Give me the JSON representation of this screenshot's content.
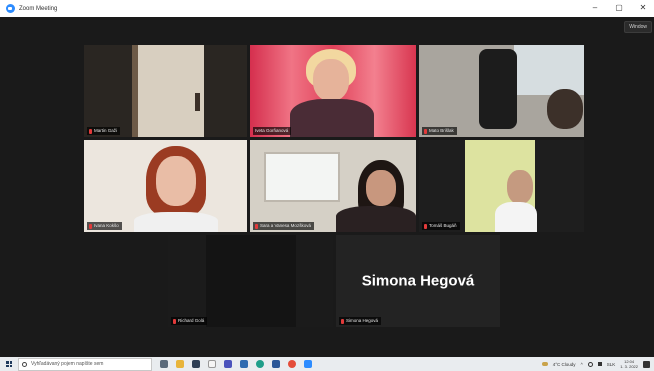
{
  "window": {
    "title": "Zoom Meeting",
    "controls": [
      "–",
      "▢",
      "✕"
    ],
    "view_button": "Window"
  },
  "participants": [
    {
      "name": "Martin Gaži",
      "muted": true
    },
    {
      "name": "Iveta Gorňanová",
      "muted": true,
      "active_speaker": true
    },
    {
      "name": "Mato Brišlak",
      "muted": true
    },
    {
      "name": "Ivana Kokšo",
      "muted": true
    },
    {
      "name": "Sara a Vanesa Mozšková",
      "muted": true
    },
    {
      "name": "Tomáš Bugáň",
      "muted": true
    },
    {
      "name": "Richard Golá",
      "muted": true
    },
    {
      "name": "Simona Hegová",
      "muted": true,
      "video_off": true,
      "display_name": "Simona Hegová"
    }
  ],
  "taskbar": {
    "search_placeholder": "Vyhľadávaný pojem napíšte sem",
    "weather": "4°C  Cloudy",
    "language": "SLK",
    "time": "12:04",
    "date": "1. 3. 2022"
  }
}
